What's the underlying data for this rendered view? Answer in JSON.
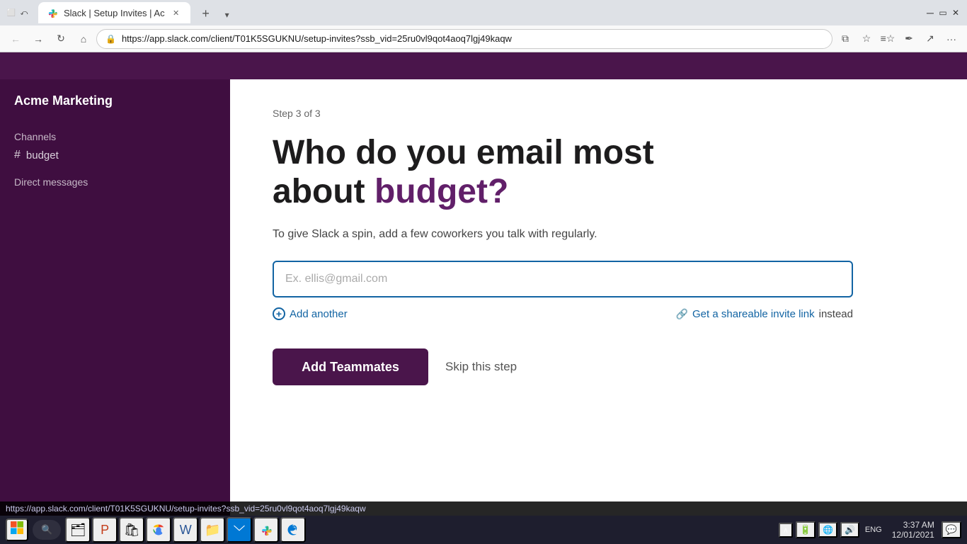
{
  "browser": {
    "tab_title": "Slack | Setup Invites | Ac",
    "url": "https://app.slack.com/client/T01K5SGUKNU/setup-invites?ssb_vid=25ru0vl9qot4aoq7lgj49kaqw",
    "status_url": "https://app.slack.com/client/T01K5SGUKNU/setup-invites?ssb_vid=25ru0vl9qot4aoq7lgj49kaqw"
  },
  "sidebar": {
    "workspace_name": "Acme Marketing",
    "sections": [
      {
        "title": "Channels",
        "items": [
          {
            "icon": "#",
            "label": "budget"
          }
        ]
      },
      {
        "title": "Direct messages",
        "items": []
      }
    ]
  },
  "main": {
    "step_indicator": "Step 3 of 3",
    "heading_part1": "Who do you email most",
    "heading_part2": "about ",
    "heading_highlight": "budget?",
    "subtitle": "To give Slack a spin, add a few coworkers you talk with regularly.",
    "email_placeholder": "Ex. ellis@gmail.com",
    "add_another_label": "Add another",
    "invite_link_label_pre": "Get a shareable invite link",
    "invite_link_label_post": "instead",
    "add_teammates_btn": "Add Teammates",
    "skip_btn": "Skip this step"
  },
  "taskbar": {
    "time": "3:37 AM",
    "date": "12/01/2021",
    "lang": "ENG",
    "apps": [
      "🪟",
      "🔍",
      "🗂",
      "🎨",
      "🛍",
      "🌐",
      "📝",
      "📁",
      "✉",
      "🟦"
    ]
  }
}
